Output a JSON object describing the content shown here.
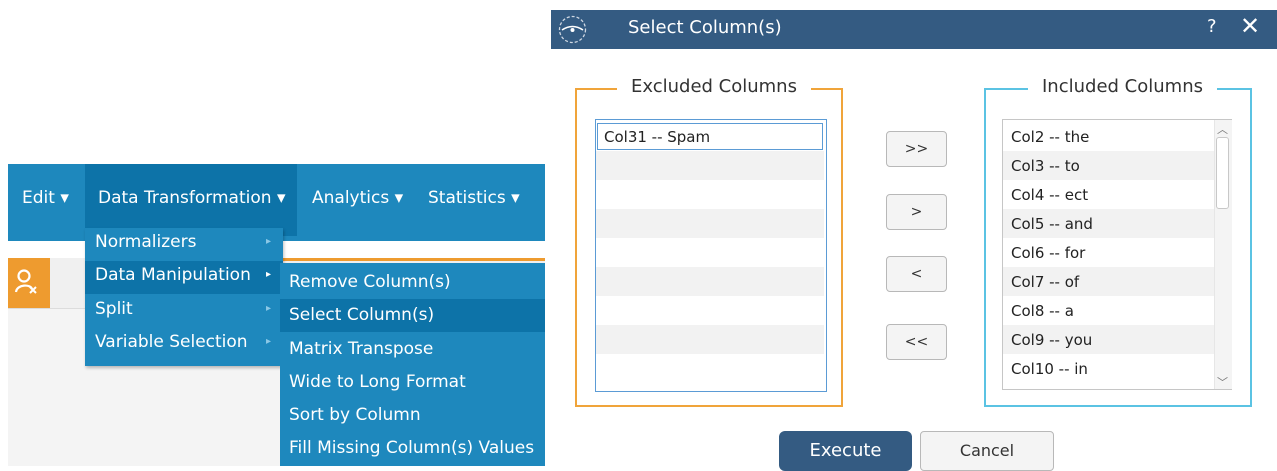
{
  "menubar": {
    "items": [
      {
        "label": "Edit ▾"
      },
      {
        "label": "Data Transformation ▾"
      },
      {
        "label": "Analytics ▾"
      },
      {
        "label": "Statistics ▾"
      }
    ]
  },
  "submenu": {
    "items": [
      {
        "label": "Normalizers",
        "arrow": "▸"
      },
      {
        "label": "Data Manipulation",
        "arrow": "▸"
      },
      {
        "label": "Split",
        "arrow": "▸"
      },
      {
        "label": "Variable Selection",
        "arrow": "▸"
      }
    ]
  },
  "data_manipulation_menu": {
    "items": [
      {
        "label": "Remove Column(s)"
      },
      {
        "label": "Select Column(s)"
      },
      {
        "label": "Matrix Transpose"
      },
      {
        "label": "Wide to Long Format"
      },
      {
        "label": "Sort by Column"
      },
      {
        "label": "Fill Missing Column(s) Values"
      }
    ]
  },
  "user_icon": "user-remove-icon",
  "dialog": {
    "title": "Select Column(s)",
    "help": "?",
    "close": "✕",
    "excluded": {
      "legend": "Excluded Columns",
      "items": [
        "Col31 -- Spam"
      ]
    },
    "included": {
      "legend": "Included Columns",
      "items": [
        "Col2 -- the",
        "Col3 -- to",
        "Col4 -- ect",
        "Col5 -- and",
        "Col6 -- for",
        "Col7 -- of",
        "Col8 -- a",
        "Col9 -- you",
        "Col10 -- in"
      ]
    },
    "buttons": {
      "add_all": ">>",
      "add": ">",
      "remove": "<",
      "remove_all": "<<",
      "execute": "Execute",
      "cancel": "Cancel"
    }
  },
  "colors": {
    "menu_blue": "#1e88bd",
    "menu_highlight": "#0d73a8",
    "dialog_title": "#345b82",
    "excluded_border": "#f0a43a",
    "included_border": "#5bc3e3"
  }
}
